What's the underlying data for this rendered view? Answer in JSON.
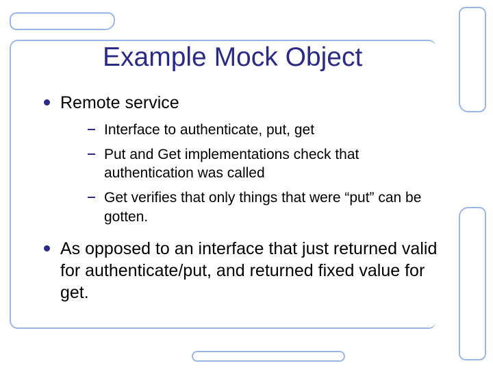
{
  "slide": {
    "title": "Example Mock Object",
    "bullets": [
      {
        "text": "Remote service",
        "sub": [
          "Interface to authenticate, put, get",
          "Put and Get implementations check that authentication was called",
          "Get verifies that only things that were “put” can be gotten."
        ]
      },
      {
        "text": "As opposed to an interface that just returned valid for authenticate/put, and returned fixed value for get.",
        "sub": []
      }
    ]
  },
  "colors": {
    "title": "#2b2b86",
    "frame": "#9bb7e6"
  }
}
